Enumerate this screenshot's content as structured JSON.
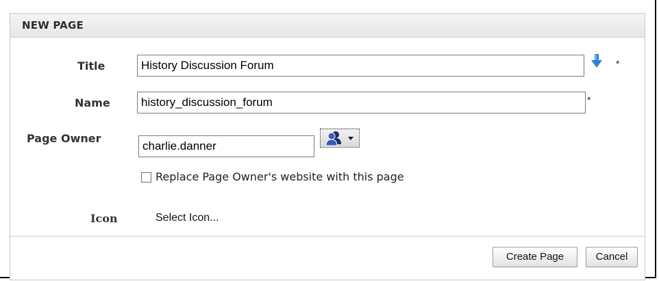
{
  "dialog": {
    "title": "NEW PAGE"
  },
  "form": {
    "title_label": "Title",
    "title_value": "History Discussion Forum",
    "name_label": "Name",
    "name_value": "history_discussion_forum",
    "owner_label": "Page Owner",
    "owner_value": "charlie.danner",
    "required_marker": "*",
    "replace_checkbox_label": "Replace Page Owner's website with this page",
    "replace_checked": false,
    "icon_label": "Icon",
    "icon_select_text": "Select Icon..."
  },
  "buttons": {
    "create_label": "Create Page",
    "cancel_label": "Cancel"
  },
  "icons": {
    "copy_down": "arrow-down-icon",
    "owner_picker": "user-picker-icon"
  },
  "colors": {
    "accent_blue": "#2f7fd8",
    "header_bg": "#ececec"
  }
}
